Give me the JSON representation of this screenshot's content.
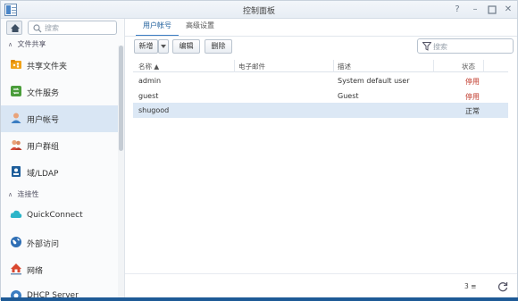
{
  "window": {
    "title": "控制面板"
  },
  "sidebar": {
    "search_placeholder": "搜索",
    "sections": [
      {
        "label": "文件共享"
      },
      {
        "label": "连接性"
      }
    ],
    "items": [
      {
        "label": "共享文件夹",
        "icon": "shared-folder-icon"
      },
      {
        "label": "文件服务",
        "icon": "file-services-icon"
      },
      {
        "label": "用户帐号",
        "icon": "user-icon",
        "active": true
      },
      {
        "label": "用户群组",
        "icon": "group-icon"
      },
      {
        "label": "域/LDAP",
        "icon": "domain-ldap-icon"
      },
      {
        "label": "QuickConnect",
        "icon": "quickconnect-icon"
      },
      {
        "label": "外部访问",
        "icon": "external-access-icon"
      },
      {
        "label": "网络",
        "icon": "network-icon"
      },
      {
        "label": "DHCP Server",
        "icon": "dhcp-server-icon"
      }
    ]
  },
  "tabs": [
    {
      "label": "用户帐号"
    },
    {
      "label": "高级设置"
    }
  ],
  "toolbar": {
    "create_label": "新增",
    "edit_label": "编辑",
    "delete_label": "删除",
    "filter_placeholder": "搜索"
  },
  "table": {
    "columns": [
      "名称",
      "电子邮件",
      "描述",
      "状态"
    ],
    "rows": [
      {
        "name": "admin",
        "email": "",
        "description": "System default user",
        "status": "停用"
      },
      {
        "name": "guest",
        "email": "",
        "description": "Guest",
        "status": "停用"
      },
      {
        "name": "shugood",
        "email": "",
        "description": "",
        "status": "正常",
        "selected": true
      }
    ]
  },
  "footer": {
    "count": "3"
  },
  "colors": {
    "accent": "#3b7dc2",
    "selected_row": "#dce8f5",
    "disabled_status": "#c0392b"
  }
}
